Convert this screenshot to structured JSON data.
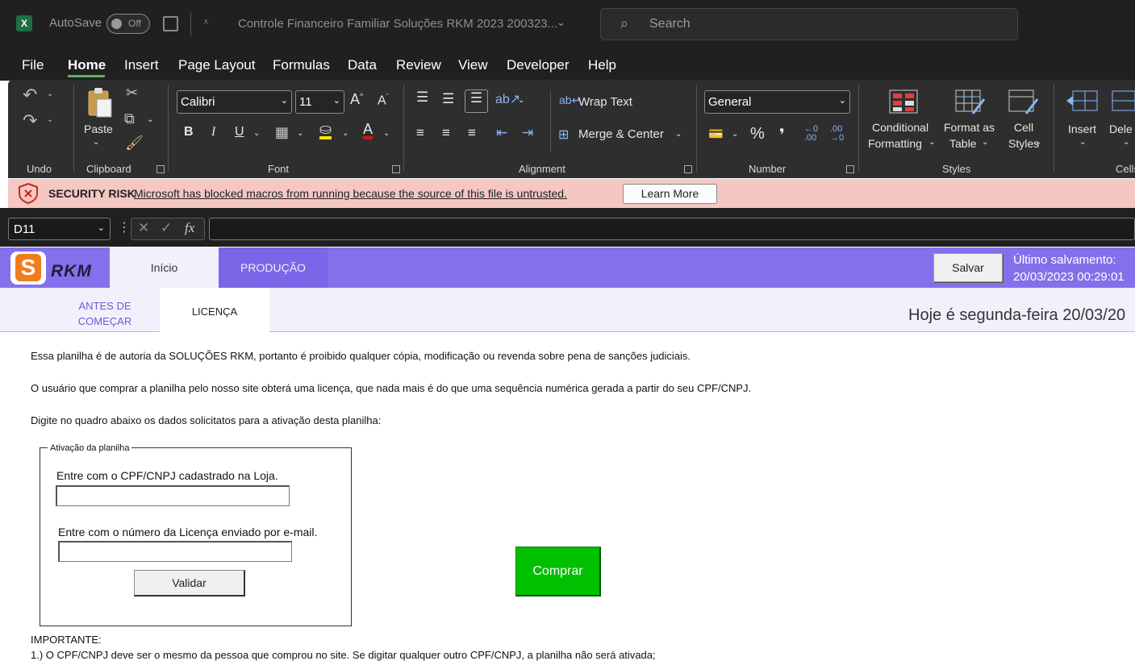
{
  "titlebar": {
    "autosave_label": "AutoSave",
    "autosave_state": "Off",
    "doc_title": "Controle Financeiro Familiar Soluções RKM 2023 200323...",
    "search_placeholder": "Search"
  },
  "menu": {
    "items": [
      "File",
      "Home",
      "Insert",
      "Page Layout",
      "Formulas",
      "Data",
      "Review",
      "View",
      "Developer",
      "Help"
    ],
    "active": "Home"
  },
  "ribbon": {
    "undo_group": "Undo",
    "clipboard_group": "Clipboard",
    "paste_label": "Paste",
    "font_group": "Font",
    "font_name": "Calibri",
    "font_size": "11",
    "bold": "B",
    "italic": "I",
    "underline": "U",
    "alignment_group": "Alignment",
    "wrap_text": "Wrap Text",
    "merge_center": "Merge & Center",
    "number_group": "Number",
    "number_format": "General",
    "percent": "%",
    "comma": "❜",
    "styles_group": "Styles",
    "conditional_formatting_1": "Conditional",
    "conditional_formatting_2": "Formatting",
    "format_table_1": "Format as",
    "format_table_2": "Table",
    "cell_styles_1": "Cell",
    "cell_styles_2": "Styles",
    "insert_label": "Insert",
    "delete_label": "Dele",
    "cells_group": "Cells"
  },
  "security": {
    "title": "SECURITY RISK",
    "message": "Microsoft has blocked macros from running because the source of this file is untrusted.",
    "learn_more": "Learn More"
  },
  "formula_bar": {
    "name_box": "D11",
    "fx": "fx",
    "value": ""
  },
  "sheet": {
    "logo_text": "RKM",
    "tabs": [
      {
        "label": "Início",
        "active": true
      },
      {
        "label": "PRODUÇÃO",
        "active": false
      }
    ],
    "save_button": "Salvar",
    "last_save_label": "Último salvamento:",
    "last_save_value": "20/03/2023 00:29:01",
    "subtabs": [
      {
        "label_line1": "ANTES DE",
        "label_line2": "COMEÇAR",
        "active": false
      },
      {
        "label_line1": "LICENÇA",
        "label_line2": "",
        "active": true
      }
    ],
    "today": "Hoje é segunda-feira 20/03/20",
    "paragraphs": [
      "Essa planilha é de autoria da SOLUÇÕES RKM, portanto é proibido qualquer cópia, modificação ou revenda sobre pena de sanções judiciais.",
      "O usuário que comprar a planilha pelo nosso site obterá uma licença, que nada mais é do que uma sequência numérica gerada a partir do seu CPF/CNPJ.",
      "Digite no quadro abaixo os dados solicitatos para a ativação desta planilha:"
    ],
    "activation": {
      "legend": "Ativação da planilha",
      "cpf_label": "Entre com o CPF/CNPJ cadastrado na Loja.",
      "cpf_value": "",
      "license_label": "Entre com o número da Licença enviado por e-mail.",
      "license_value": "",
      "validate_button": "Validar"
    },
    "buy_button": "Comprar",
    "important_title": "IMPORTANTE:",
    "important_1": "1.) O CPF/CNPJ deve ser o mesmo da pessoa que comprou no site. Se digitar qualquer outro CPF/CNPJ, a planilha não será ativada;"
  },
  "colors": {
    "nav_purple": "#8470ea",
    "subnav_bg": "#f3f0fc",
    "comprar_green": "#00c000",
    "security_bg": "#f4c7c3",
    "excel_green": "#1d6f42"
  }
}
